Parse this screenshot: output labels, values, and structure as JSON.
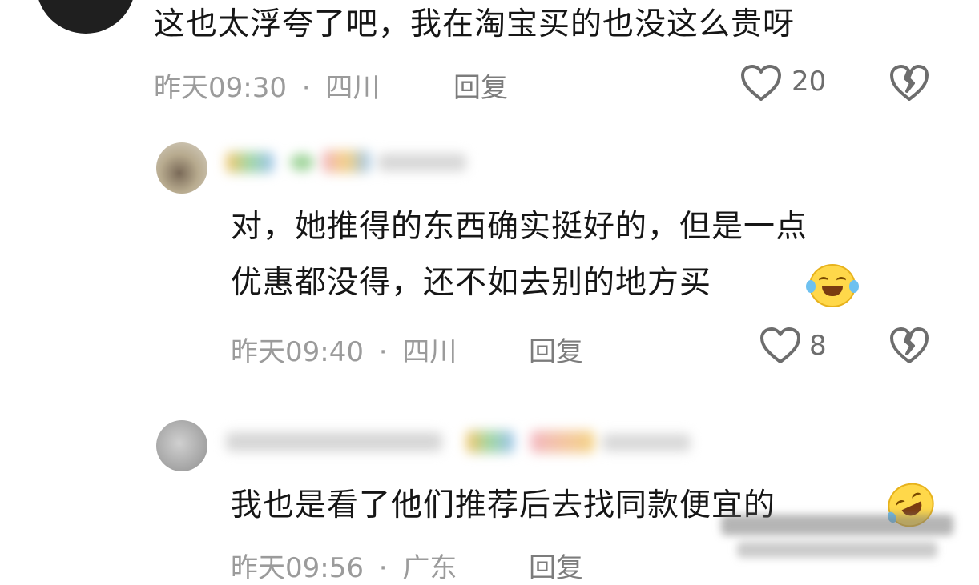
{
  "comments": [
    {
      "id": "c1",
      "text_lines": [
        "这也太浮夸了吧，我在淘宝买的也没这么贵呀"
      ],
      "time": "昨天09:30",
      "separator": "·",
      "location": "四川",
      "reply_label": "回复",
      "like_count": "20",
      "like_icon": "heart-outline-icon",
      "dislike_icon": "broken-heart-icon",
      "avatar_color": "#1f1f1f"
    },
    {
      "id": "c2",
      "text_lines": [
        "对，她推得的东西确实挺好的，但是一点",
        "优惠都没得，还不如去别的地方买"
      ],
      "time": "昨天09:40",
      "separator": "·",
      "location": "四川",
      "reply_label": "回复",
      "like_count": "8",
      "like_icon": "heart-outline-icon",
      "dislike_icon": "broken-heart-icon",
      "emoji": "crying-laughing-emoji",
      "avatar_color": "#b7aa8e"
    },
    {
      "id": "c3",
      "text_lines": [
        "我也是看了他们推荐后去找同款便宜的"
      ],
      "time": "昨天09:56",
      "separator": "·",
      "location": "广东",
      "reply_label": "回复",
      "emoji": "rolling-laughing-emoji",
      "avatar_color": "#b5b5b5"
    }
  ],
  "colors": {
    "text": "#161616",
    "meta": "#9b9b9b",
    "icon": "#6d6d6d"
  }
}
